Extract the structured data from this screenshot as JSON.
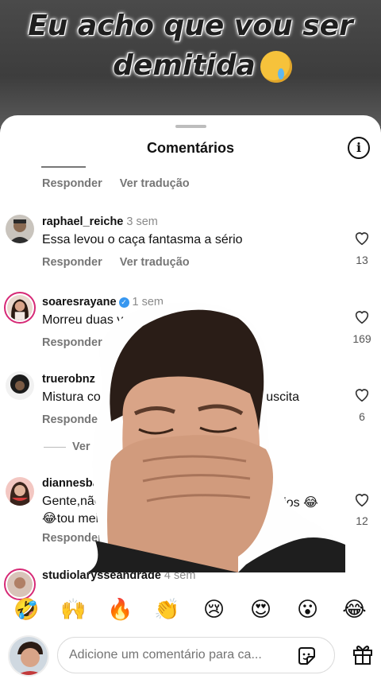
{
  "video": {
    "caption_line1": "Eu acho que vou ser",
    "caption_line2": "demitida"
  },
  "sheet": {
    "title": "Comentários"
  },
  "top_partial": {
    "reply_label": "Responder",
    "translate_label": "Ver tradução"
  },
  "comments": [
    {
      "username": "raphael_reiche",
      "time": "3 sem",
      "text": "Essa levou o caça fantasma a sério",
      "reply_label": "Responder",
      "translate_label": "Ver tradução",
      "likes": "13"
    },
    {
      "username": "soaresrayane",
      "time": "1 sem",
      "text": "Morreu duas vezes",
      "reply_label": "Responder",
      "likes": "169"
    },
    {
      "username": "truerobnz",
      "text": "Mistura co",
      "text_tail": "ressuscita",
      "reply_label": "Responder",
      "likes": "6"
    },
    {
      "username": "diannesbaixinh",
      "text_line1": "Gente,não co",
      "text_line1_tail": "ários 😂",
      "text_line2": "😂tou meia l",
      "reply_label": "Responder",
      "likes": "12"
    },
    {
      "username": "studiolarysseandrade",
      "time": "4 sem"
    }
  ],
  "view_more": "Ver mais",
  "emoji_bar": [
    "🤣",
    "🙌",
    "🔥",
    "👏",
    "😢",
    "😍",
    "😮",
    "😂"
  ],
  "input": {
    "placeholder": "Adicione um comentário para ca..."
  },
  "colors": {
    "verified": "#3797f0",
    "story_ring": "#d62976"
  }
}
